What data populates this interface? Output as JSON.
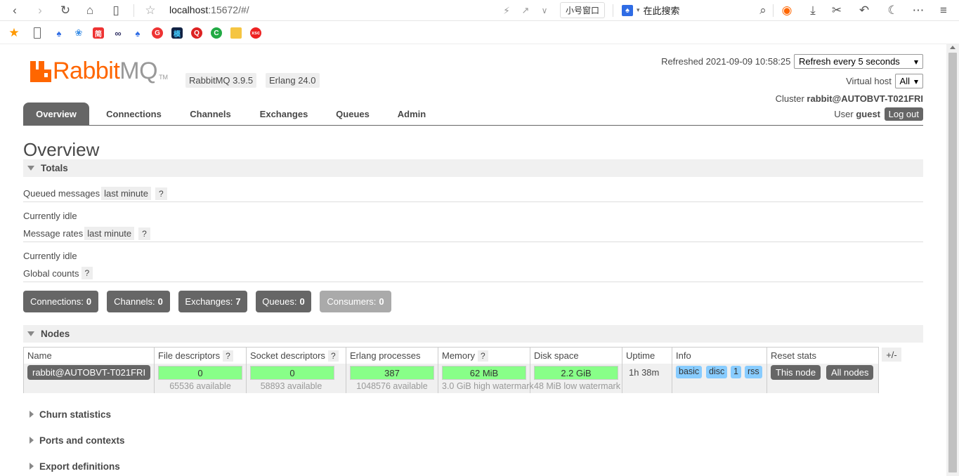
{
  "browser": {
    "address": "localhost",
    "address_path": ":15672/#/",
    "small_window": "小号窗口",
    "search_placeholder": "在此搜索"
  },
  "header": {
    "logo_rabbit": "Rabbit",
    "logo_mq": "MQ",
    "logo_tm": "TM",
    "version": "RabbitMQ 3.9.5",
    "erlang": "Erlang 24.0",
    "refreshed": "Refreshed 2021-09-09 10:58:25",
    "refresh_option": "Refresh every 5 seconds",
    "vhost_label": "Virtual host",
    "vhost_value": "All",
    "cluster_label": "Cluster",
    "cluster_name": "rabbit@AUTOBVT-T021FRI",
    "user_label": "User",
    "user_name": "guest",
    "logout": "Log out"
  },
  "tabs": [
    "Overview",
    "Connections",
    "Channels",
    "Exchanges",
    "Queues",
    "Admin"
  ],
  "page_title": "Overview",
  "totals": {
    "heading": "Totals",
    "queued_label": "Queued messages",
    "queued_period": "last minute",
    "help": "?",
    "idle1": "Currently idle",
    "rates_label": "Message rates",
    "rates_period": "last minute",
    "idle2": "Currently idle",
    "global_label": "Global counts",
    "counts": [
      {
        "label": "Connections:",
        "value": "0"
      },
      {
        "label": "Channels:",
        "value": "0"
      },
      {
        "label": "Exchanges:",
        "value": "7"
      },
      {
        "label": "Queues:",
        "value": "0"
      },
      {
        "label": "Consumers:",
        "value": "0"
      }
    ]
  },
  "nodes": {
    "heading": "Nodes",
    "columns": [
      "Name",
      "File descriptors",
      "Socket descriptors",
      "Erlang processes",
      "Memory",
      "Disk space",
      "Uptime",
      "Info",
      "Reset stats"
    ],
    "plusminus": "+/-",
    "row": {
      "name": "rabbit@AUTOBVT-T021FRI",
      "fd_used": "0",
      "fd_avail": "65536 available",
      "sock_used": "0",
      "sock_avail": "58893 available",
      "proc_used": "387",
      "proc_avail": "1048576 available",
      "mem_used": "62 MiB",
      "mem_watermark": "3.0 GiB high watermark",
      "disk_free": "2.2 GiB",
      "disk_watermark": "48 MiB low watermark",
      "uptime": "1h 38m",
      "info_tags": [
        "basic",
        "disc",
        "1",
        "rss"
      ],
      "reset_this": "This node",
      "reset_all": "All nodes"
    }
  },
  "collapsed_sections": [
    "Churn statistics",
    "Ports and contexts",
    "Export definitions"
  ]
}
